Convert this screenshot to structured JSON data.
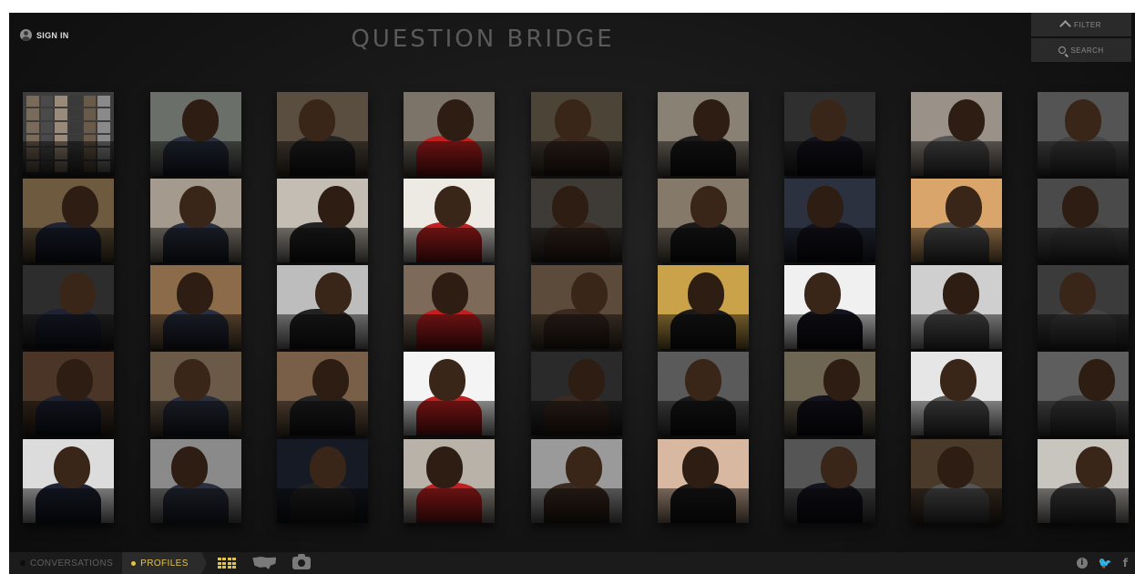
{
  "header": {
    "sign_in_label": "SIGN IN",
    "logo_text": "QUESTION BRIDGE",
    "filter_label": "FILTER",
    "search_label": "SEARCH"
  },
  "bottom_nav": {
    "conversations_label": "CONVERSATIONS",
    "profiles_label": "PROFILES",
    "active": "PROFILES",
    "view_icons": [
      "grid-icon",
      "map-icon",
      "camera-icon"
    ],
    "social_icons": [
      "info-icon",
      "twitter-icon",
      "facebook-icon"
    ],
    "info_glyph": "i",
    "twitter_glyph": "🐦",
    "facebook_glyph": "f"
  },
  "colors": {
    "accent": "#e2c34a",
    "background": "#151515",
    "bar": "#1b1b1b"
  },
  "profiles": {
    "rows": 5,
    "columns": 9,
    "count": 45
  }
}
